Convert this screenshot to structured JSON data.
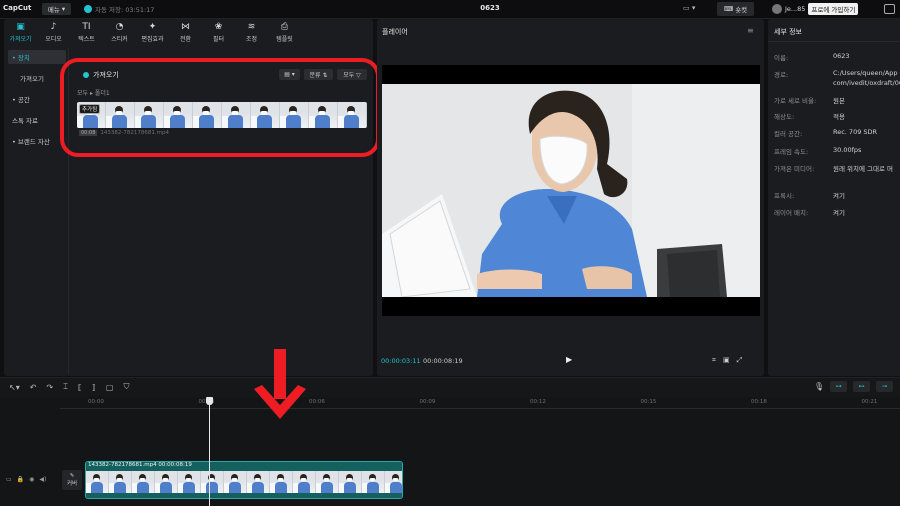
{
  "app": {
    "logo": "CapCut",
    "menu_label": "메뉴",
    "autosave_text": "자동 저장: 03:51:17",
    "project_title": "0623",
    "shortcut_label": "숏컷",
    "user_name": "Je...85",
    "join_label": "프로에 가입하기"
  },
  "tool_tabs": [
    {
      "icon": "▣",
      "label": "가져오기"
    },
    {
      "icon": "♪",
      "label": "오디오"
    },
    {
      "icon": "TI",
      "label": "텍스트"
    },
    {
      "icon": "◔",
      "label": "스티커"
    },
    {
      "icon": "✦",
      "label": "편집효과"
    },
    {
      "icon": "⋈",
      "label": "전환"
    },
    {
      "icon": "❀",
      "label": "필터"
    },
    {
      "icon": "≋",
      "label": "조정"
    },
    {
      "icon": "⎙",
      "label": "템플릿"
    }
  ],
  "left_nav": [
    {
      "label": "• 장치",
      "active": true,
      "sub": false
    },
    {
      "label": "가져오기",
      "active": false,
      "sub": true
    },
    {
      "label": "• 공간",
      "active": false,
      "sub": false
    },
    {
      "label": "스톡 자료",
      "active": false,
      "sub": false
    },
    {
      "label": "• 브랜드 자산",
      "active": false,
      "sub": false
    }
  ],
  "media": {
    "header": "가져오기",
    "view_label": "▤ ▾",
    "sort_label": "분류 ⇅",
    "filter_label": "모두 ▽",
    "breadcrumb": "모두 ▸ 폴더1",
    "added_badge": "추가됨",
    "filename": "143382-782178681.mp4",
    "filename_chip": "00:08"
  },
  "player": {
    "title": "플레이어",
    "menu_icon": "≡",
    "time_current": "00:00:03:11",
    "time_total": "00:00:08:19",
    "play_icon": "▶",
    "tools": [
      "⌗",
      "▣",
      "⤢"
    ]
  },
  "details": {
    "title": "세부 정보",
    "rows": [
      {
        "label": "이름:",
        "value": "0623"
      },
      {
        "label": "경로:",
        "value": "C:/Users/queen/App"
      },
      {
        "label": "",
        "value": "com/ivedit/oxdraft/06"
      },
      {
        "label": "가로 세로 비율:",
        "value": "원본"
      },
      {
        "label": "해상도:",
        "value": "적용"
      },
      {
        "label": "컬러 공간:",
        "value": "Rec. 709 SDR"
      },
      {
        "label": "프레임 속도:",
        "value": "30.00fps"
      },
      {
        "label": "가져온 미디어:",
        "value": "원래 위치에 그대로 머"
      },
      {
        "label": "프록시:",
        "value": "켜기"
      },
      {
        "label": "레이어 배치:",
        "value": "켜기"
      }
    ]
  },
  "timeline": {
    "ticks": [
      "00:00",
      "00:03",
      "00:06",
      "00:09",
      "00:12",
      "00:15",
      "00:18",
      "00:21"
    ],
    "clip_label": "143382-782178681.mp4  00:00:08:19",
    "cover_label": "커버"
  },
  "colors": {
    "accent": "#21c6d1",
    "highlight": "#ee1d24",
    "clip": "#14605f"
  }
}
